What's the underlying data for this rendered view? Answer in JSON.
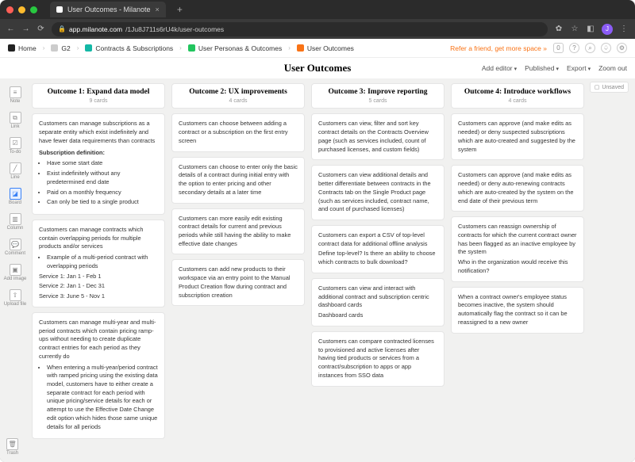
{
  "browser": {
    "tab_title": "User Outcomes - Milanote",
    "url_host": "app.milanote.com",
    "url_path": "/1Ju8J711s6rU4k/user-outcomes",
    "avatar_initial": "J"
  },
  "breadcrumbs": {
    "home": "Home",
    "items": [
      "G2",
      "Contracts & Subscriptions",
      "User Personas & Outcomes",
      "User Outcomes"
    ],
    "refer": "Refer a friend, get more space »",
    "badge_count": "0"
  },
  "header": {
    "title": "User Outcomes",
    "actions": {
      "add_editor": "Add editor",
      "published": "Published",
      "export": "Export",
      "zoom_out": "Zoom out"
    }
  },
  "tools": {
    "items": [
      "Note",
      "Link",
      "To-do",
      "Line",
      "Board",
      "Column",
      "Comment",
      "Add image",
      "Upload file"
    ],
    "trash": "Trash"
  },
  "unsaved_label": "Unsaved",
  "columns": [
    {
      "title": "Outcome 1: Expand data model",
      "count": "9 cards",
      "cards": [
        {
          "text": "Customers can manage subscriptions as a separate entity which exist indefinitely and have fewer data requirements than contracts",
          "sub_heading": "Subscription definition:",
          "bullets": [
            "Have some start date",
            "Exist indefinitely without any predetermined end date",
            "Paid on a monthly frequency",
            "Can only be tied to a single product"
          ]
        },
        {
          "text": "Customers can manage contracts which contain overlapping periods for multiple products and/or services",
          "bullets": [
            "Example of a multi-period contract with overlapping periods"
          ],
          "lines": [
            "Service 1: Jan 1 - Feb 1",
            "Service 2: Jan 1 - Dec 31",
            "Service 3: June 5 - Nov 1"
          ]
        },
        {
          "text": "Customers can manage multi-year and multi-period contracts which contain pricing ramp-ups without needing to create duplicate contract entries for each period as they currently do",
          "bullets": [
            "When entering a multi-year/period contract with ramped pricing using the existing data model, customers have to either create a separate contract for each period with unique pricing/service details for each or attempt to use the Effective Date Change edit option which hides those same unique details for all periods"
          ]
        }
      ]
    },
    {
      "title": "Outcome 2: UX improvements",
      "count": "4 cards",
      "cards": [
        {
          "text": "Customers can choose between adding a contract or a subscription on the first entry screen"
        },
        {
          "text": "Customers can choose to enter only the basic details of a contract during initial entry with the option to enter pricing and other secondary details at a later time"
        },
        {
          "text": "Customers can more easily edit existing contract details for current and previous periods while still having the ability to make effective date changes"
        },
        {
          "text": "Customers can add new products to their workspace via an entry point to the Manual Product Creation flow during contract and subscription creation"
        }
      ]
    },
    {
      "title": "Outcome 3: Improve reporting",
      "count": "5 cards",
      "cards": [
        {
          "text": "Customers can view, filter and sort key contract details on the Contracts Overview page (such as services included, count of purchased licenses, and custom fields)"
        },
        {
          "text": "Customers can view additional details and better differentiate between contracts in the Contracts tab on the Single Product page (such as services included, contract name, and count of purchased licenses)"
        },
        {
          "text": "Customers can export a CSV of top-level contract data for additional offline analysis",
          "lines": [
            "Define top-level? Is there an ability to choose which contracts to bulk download?"
          ]
        },
        {
          "text": "Customers can view and interact with additional contract and subscription centric dashboard cards",
          "lines": [
            "Dashboard cards"
          ]
        },
        {
          "text": "Customers can compare contracted licenses to provisioned and active licenses after having tied products or services from a contract/subscription to apps or app instances from SSO data"
        }
      ]
    },
    {
      "title": "Outcome 4: Introduce workflows",
      "count": "4 cards",
      "cards": [
        {
          "text": "Customers can approve (and make edits as needed) or deny suspected subscriptions which are auto-created and suggested by the system"
        },
        {
          "text": "Customers can approve (and make edits as needed) or deny auto-renewing contracts which are auto-created by the system on the end date of their previous term"
        },
        {
          "text": "Customers can reassign ownership of contracts for which the current contract owner has been flagged as an inactive employee by the system",
          "lines": [
            "Who in the organization would receive this notification?"
          ]
        },
        {
          "text": "When a contract owner's employee status becomes inactive, the system should automatically flag the contract so it can be reassigned to a new owner"
        }
      ]
    }
  ]
}
